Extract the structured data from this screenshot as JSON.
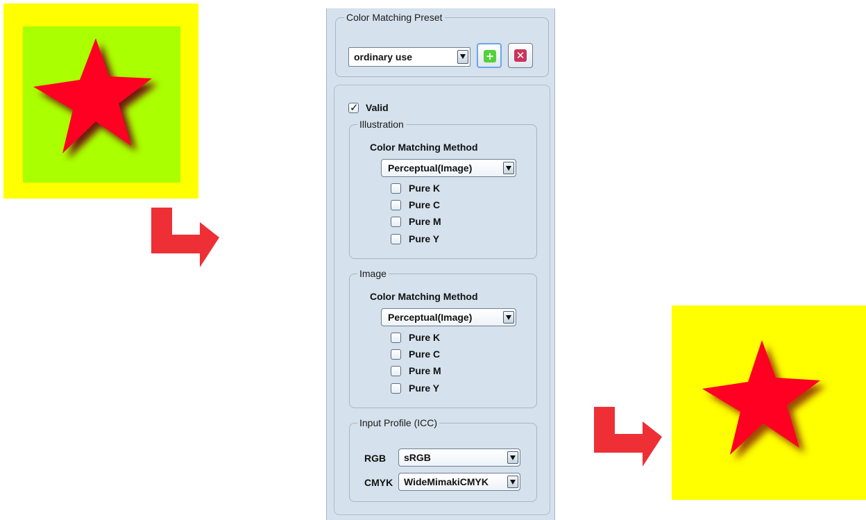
{
  "colors": {
    "yellow": "#ffff00",
    "green": "#aaff00",
    "star_red": "#ff0022",
    "arrow_red": "#ee3036",
    "panel_bg": "#d5e1ec"
  },
  "preset": {
    "title": "Color Matching Preset",
    "selected": "ordinary use",
    "add_icon": "plus-icon",
    "delete_icon": "x-icon"
  },
  "valid": {
    "label": "Valid",
    "checked": true
  },
  "illustration": {
    "title": "Illustration",
    "method_label": "Color Matching Method",
    "method_selected": "Perceptual(Image)",
    "options": [
      {
        "label": "Pure K",
        "checked": false
      },
      {
        "label": "Pure C",
        "checked": false
      },
      {
        "label": "Pure M",
        "checked": false
      },
      {
        "label": "Pure Y",
        "checked": false
      }
    ]
  },
  "image": {
    "title": "Image",
    "method_label": "Color Matching Method",
    "method_selected": "Perceptual(Image)",
    "options": [
      {
        "label": "Pure K",
        "checked": false
      },
      {
        "label": "Pure C",
        "checked": false
      },
      {
        "label": "Pure M",
        "checked": false
      },
      {
        "label": "Pure Y",
        "checked": false
      }
    ]
  },
  "input_profile": {
    "title": "Input Profile (ICC)",
    "rgb_label": "RGB",
    "rgb_selected": "sRGB",
    "cmyk_label": "CMYK",
    "cmyk_selected": "WideMimakiCMYK"
  }
}
